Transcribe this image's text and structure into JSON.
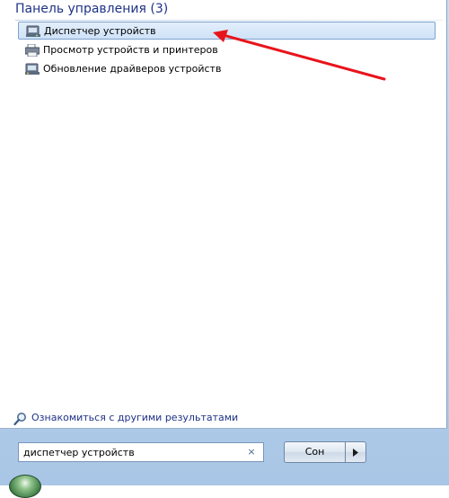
{
  "start_menu": {
    "group_header": "Панель управления (3)",
    "results": [
      {
        "label": "Диспетчер устройств",
        "icon": "device-manager-icon",
        "selected": true
      },
      {
        "label": "Просмотр устройств и принтеров",
        "icon": "devices-printers-icon",
        "selected": false
      },
      {
        "label": "Обновление драйверов устройств",
        "icon": "driver-update-icon",
        "selected": false
      }
    ],
    "more_results_label": "Ознакомиться с другими результатами",
    "search": {
      "value": "диспетчер устройств",
      "clear_glyph": "×"
    },
    "shutdown_label": "Сон"
  },
  "annotation": {
    "arrow_color": "#e8141b",
    "points_to": "Диспетчер устройств"
  },
  "colors": {
    "header_text": "#1e3287",
    "selection_border": "#7da2ce",
    "frame_background": "#b9d1ec"
  }
}
